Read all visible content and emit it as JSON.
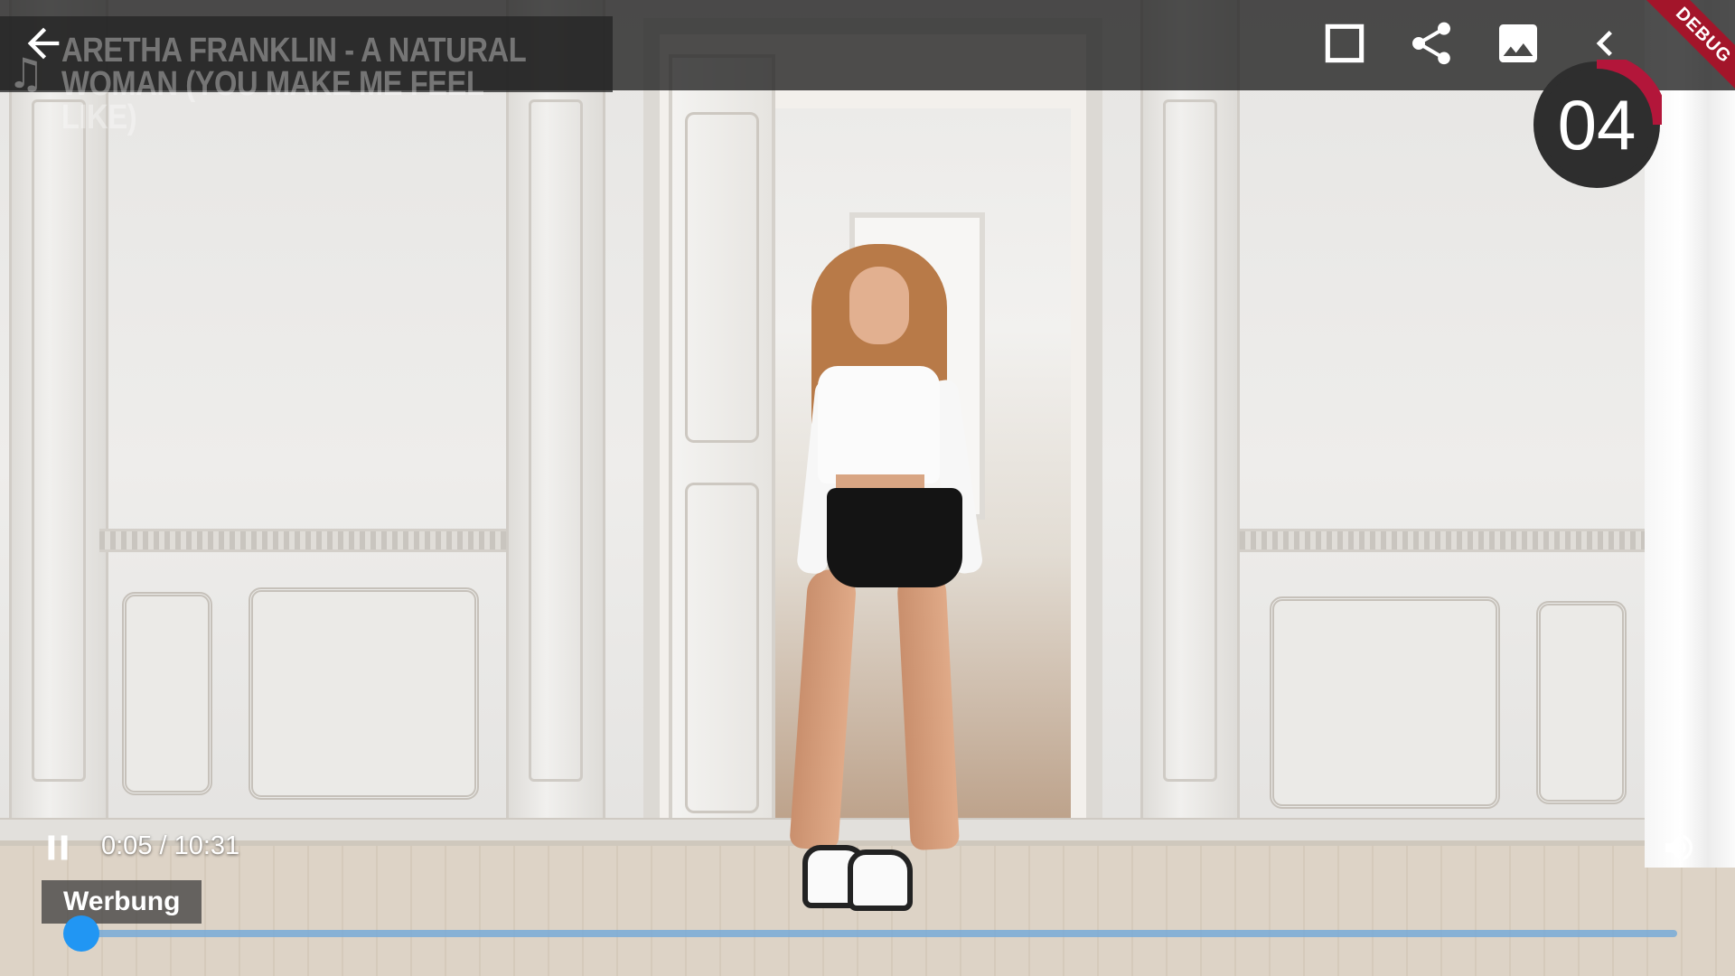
{
  "app": {
    "song_title": "Aretha Franklin - A Natural Woman (You Make Me Feel Like)",
    "countdown": "04",
    "debug_label": "DEBUG"
  },
  "toolbar": {
    "icons": [
      "back-arrow-icon",
      "fullscreen-square-icon",
      "share-icon",
      "image-icon",
      "chevron-left-icon"
    ]
  },
  "player": {
    "current_time": "0:05",
    "duration": "10:31",
    "time_display": "0:05 / 10:31",
    "ad_label": "Werbung",
    "progress_fraction": 0.008,
    "state": "playing"
  },
  "colors": {
    "accent": "#2196f3",
    "debug_banner": "#a3152a",
    "countdown_ring": "#b3163a",
    "countdown_bg": "#2e2e2e"
  }
}
